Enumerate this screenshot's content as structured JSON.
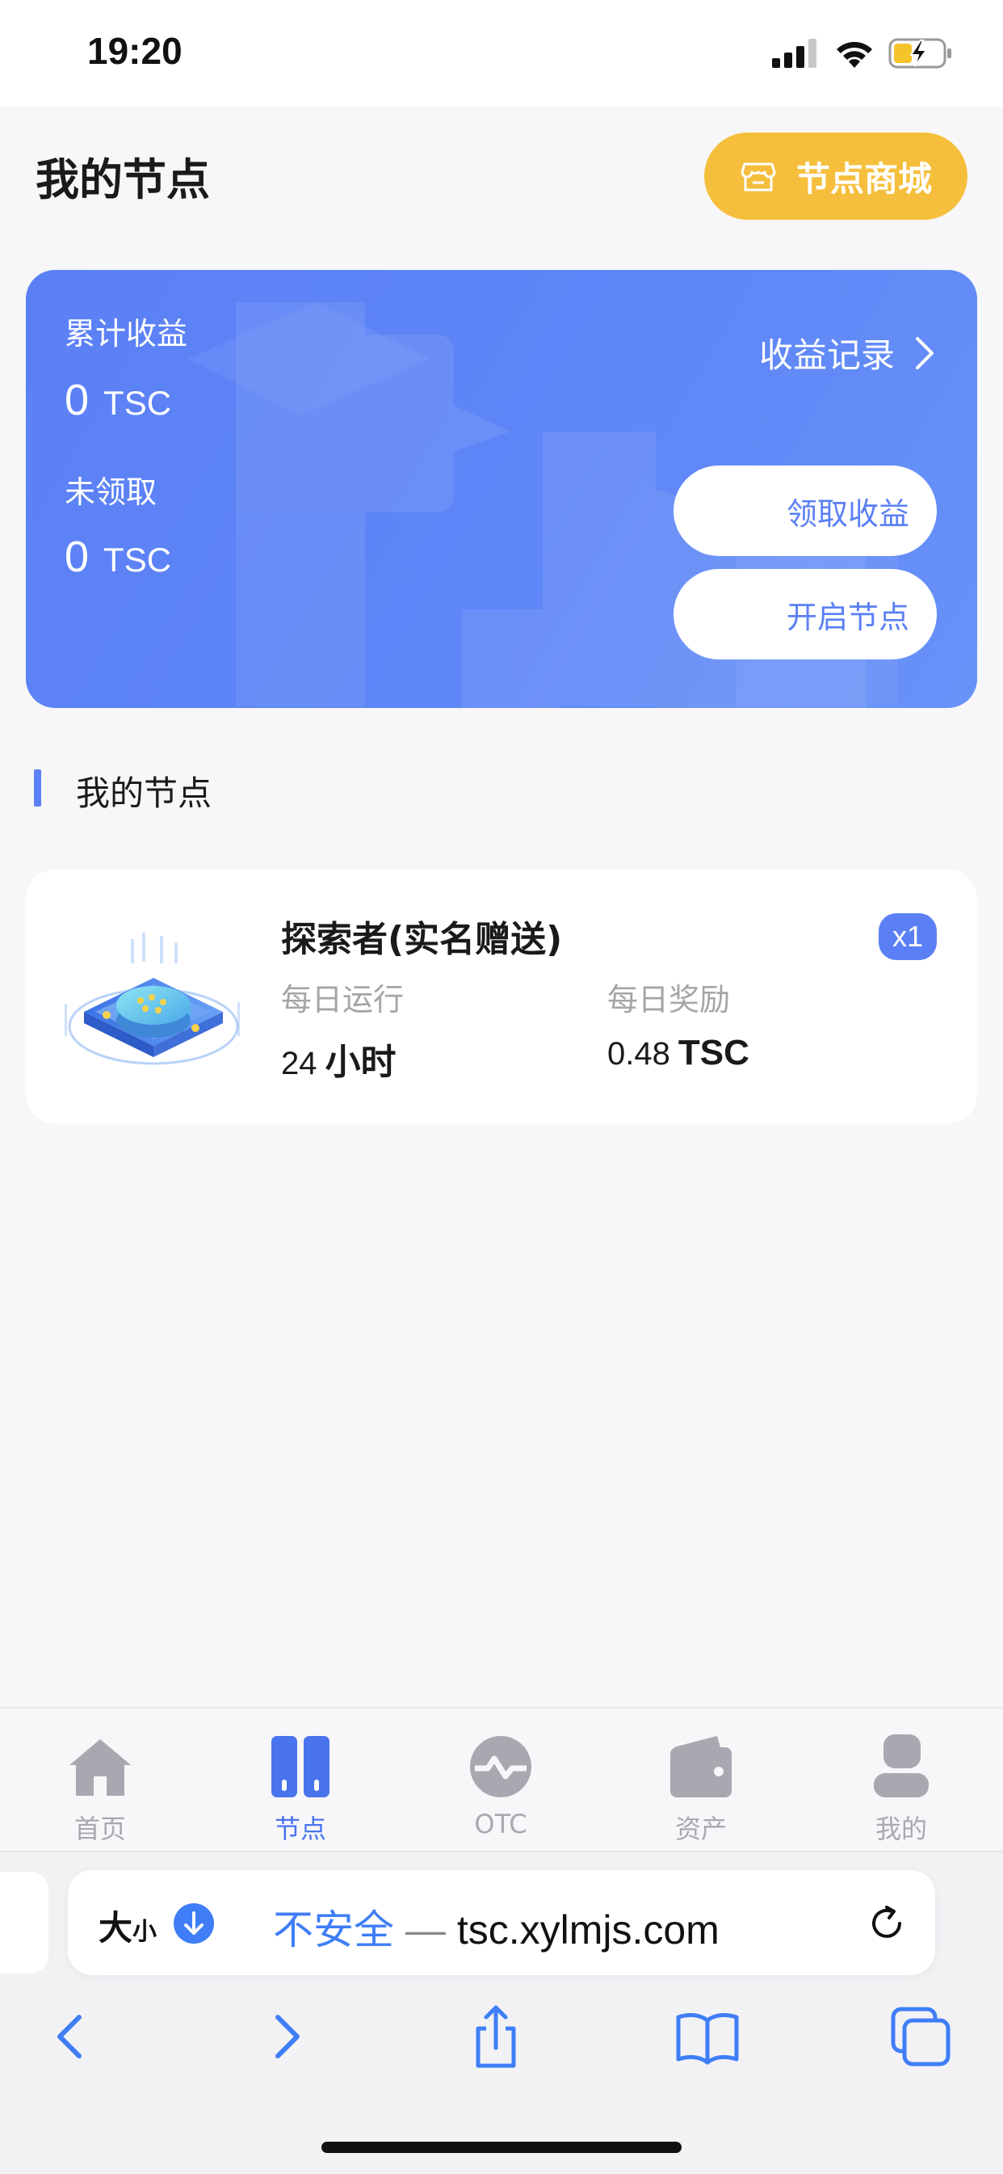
{
  "status_bar": {
    "time": "19:20"
  },
  "header": {
    "title": "我的节点",
    "shop_button": "节点商城"
  },
  "earnings": {
    "cumulative_label": "累计收益",
    "cumulative_value": "0",
    "cumulative_unit": "TSC",
    "unclaimed_label": "未领取",
    "unclaimed_value": "0",
    "unclaimed_unit": "TSC",
    "record_link": "收益记录",
    "claim_button": "领取收益",
    "start_node_button": "开启节点"
  },
  "section": {
    "title": "我的节点"
  },
  "node": {
    "name": "探索者(实名赠送)",
    "badge": "x1",
    "daily_run_label": "每日运行",
    "daily_run_value": "24",
    "daily_run_unit": "小时",
    "daily_reward_label": "每日奖励",
    "daily_reward_value": "0.48",
    "daily_reward_unit": "TSC"
  },
  "tabbar": {
    "items": [
      {
        "label": "首页",
        "icon": "home-icon",
        "active": false
      },
      {
        "label": "节点",
        "icon": "node-icon",
        "active": true
      },
      {
        "label": "OTC",
        "icon": "otc-icon",
        "active": false
      },
      {
        "label": "资产",
        "icon": "wallet-icon",
        "active": false
      },
      {
        "label": "我的",
        "icon": "profile-icon",
        "active": false
      }
    ]
  },
  "browser": {
    "text_size_large": "大",
    "text_size_small": "小",
    "insecure_label": "不安全",
    "separator": "—",
    "host": "tsc.xylmjs.com"
  },
  "colors": {
    "accent": "#5b80f5",
    "shop_button": "#f5bf3d",
    "tab_active": "#4a74ee",
    "tab_inactive": "#a8a8b0"
  }
}
